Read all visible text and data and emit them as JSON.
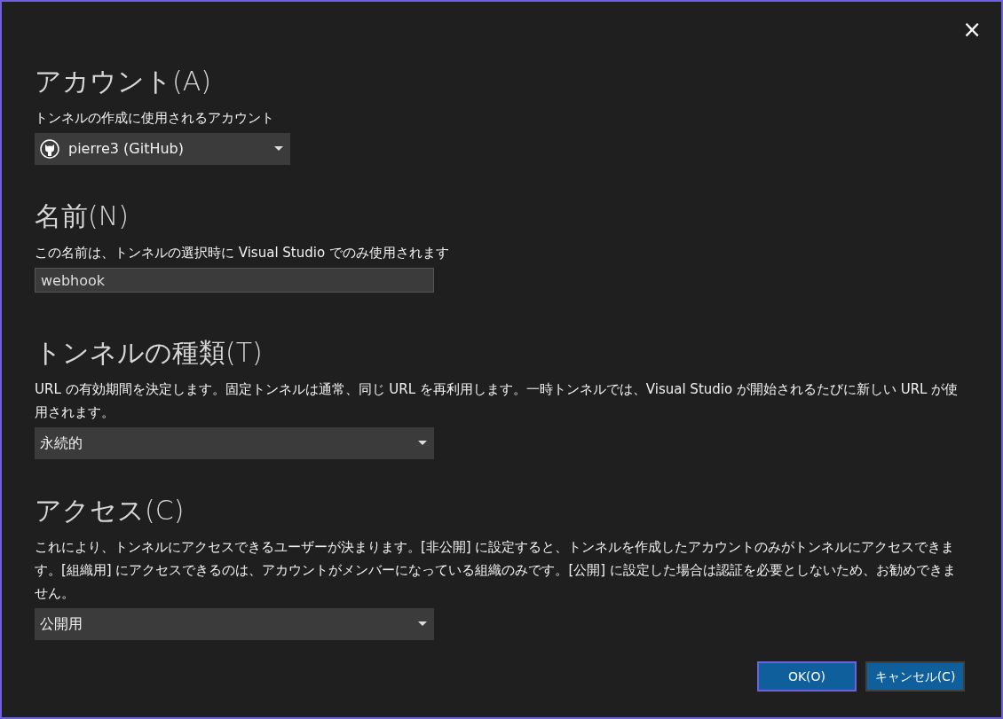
{
  "close_button": "×",
  "sections": [
    {
      "heading": "アカウント(A)",
      "description": "トンネルの作成に使用されるアカウント",
      "control": {
        "kind": "dropdown",
        "value": "pierre3 (GitHub)"
      }
    },
    {
      "heading": "名前(N)",
      "description": "この名前は、トンネルの選択時に Visual Studio でのみ使用されます",
      "control": {
        "kind": "text",
        "value": "webhook"
      }
    },
    {
      "heading": "トンネルの種類(T)",
      "description": "URL の有効期間を決定します。固定トンネルは通常、同じ URL を再利用します。一時トンネルでは、Visual Studio が開始されるたびに新しい URL が使用されます。",
      "control": {
        "kind": "dropdown",
        "value": "永続的"
      }
    },
    {
      "heading": "アクセス(C)",
      "description": "これにより、トンネルにアクセスできるユーザーが決まります。[非公開] に設定すると、トンネルを作成したアカウントのみがトンネルにアクセスできます。[組織用] にアクセスできるのは、アカウントがメンバーになっている組織のみです。[公開] に設定した場合は認証を必要としないため、お勧めできません。",
      "control": {
        "kind": "dropdown",
        "value": "公開用"
      }
    }
  ],
  "buttons": [
    {
      "label": "OK(O)",
      "focused": true
    },
    {
      "label": "キャンセル(C)",
      "focused": false
    }
  ]
}
